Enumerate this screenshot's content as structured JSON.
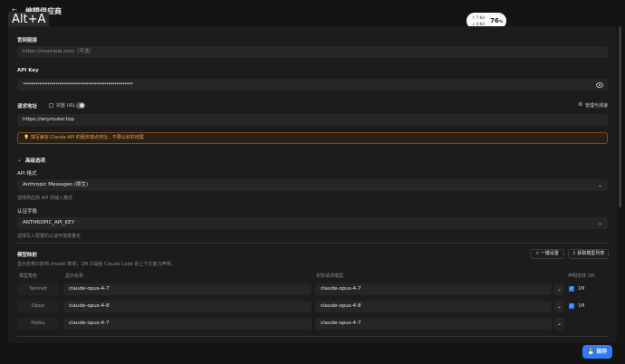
{
  "header": {
    "shortcut": "Alt+A",
    "title": "编辑供应商",
    "net_up": "↑ 7 K/s",
    "net_down": "↓ 4 K/s",
    "cpu_percent": "76",
    "cpu_unit": "%"
  },
  "form": {
    "website_label": "官网链接",
    "website_placeholder": "https://example.com（可选）",
    "apikey_label": "API Key",
    "apikey_value": "••••••••••••••••••••••••••••••••••••••••••••••••••••••",
    "endpoint_label": "请求地址",
    "full_url_label": "完整 URL",
    "manage_test_label": "管理与测速",
    "endpoint_value": "https://anyrouter.top",
    "warning_text": "填写兼容 Claude API 的服务端点地址，不要以斜杠结尾"
  },
  "advanced": {
    "section_label": "高级选项",
    "api_format_label": "API 格式",
    "api_format_value": "Anthropic Messages (原生)",
    "api_format_hint": "选择供应商 API 的输入格式",
    "auth_field_label": "认证字段",
    "auth_field_value": "ANTHROPIC_API_KEY",
    "auth_field_hint": "选择写入配置的认证环境变量名"
  },
  "model_map": {
    "title": "模型映射",
    "hint": "显示名称只影响 /model 菜单；1M 只是给 Claude Code 的上下文能力声明。",
    "oneclick_button": "一键设置",
    "fetch_button": "获取模型列表",
    "col_role": "模型角色",
    "col_display": "显示名称",
    "col_actual": "实际请求模型",
    "col_1m": "声明支持 1M",
    "rows": [
      {
        "role": "Sonnet",
        "display": "claude-opus-4-7",
        "actual": "claude-opus-4-7",
        "one_m": "1M",
        "one_m_checked": true
      },
      {
        "role": "Opus",
        "display": "claude-opus-4-8",
        "actual": "claude-opus-4-8",
        "one_m": "1M",
        "one_m_checked": true
      },
      {
        "role": "Haiku",
        "display": "claude-opus-4-7",
        "actual": "claude-opus-4-7",
        "one_m": "",
        "one_m_checked": false
      }
    ]
  },
  "footer": {
    "save_label": "保存"
  },
  "colors": {
    "accent": "#2f7cf6",
    "warning": "#e8a050",
    "panel": "#1c1c1c"
  }
}
